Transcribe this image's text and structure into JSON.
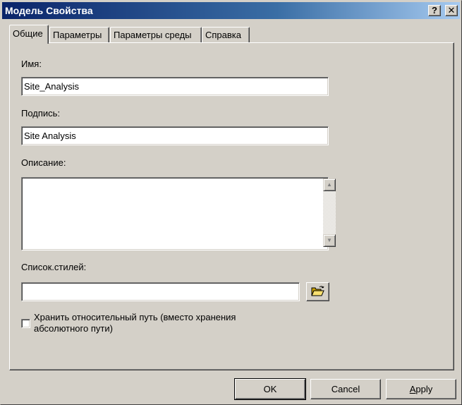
{
  "window": {
    "title": "Модель Свойства",
    "help_glyph": "?",
    "close_glyph": "✕"
  },
  "tabs": [
    {
      "label": "Общие",
      "active": true
    },
    {
      "label": "Параметры",
      "active": false
    },
    {
      "label": "Параметры среды",
      "active": false
    },
    {
      "label": "Справка",
      "active": false
    }
  ],
  "general": {
    "name_label": "Имя:",
    "name_value": "Site_Analysis",
    "caption_label": "Подпись:",
    "caption_value": "Site Analysis",
    "description_label": "Описание:",
    "description_value": "",
    "stylesheet_label": "Список.стилей:",
    "stylesheet_value": "",
    "browse_icon": "open-folder-icon",
    "relative_path_checked": false,
    "relative_path_label": "Хранить относительный путь (вместо хранения абсолютного пути)"
  },
  "buttons": {
    "ok": "OK",
    "cancel": "Cancel",
    "apply_first": "A",
    "apply_rest": "pply"
  },
  "colors": {
    "title_start": "#0a246a",
    "title_end": "#a6caf0",
    "face": "#d4d0c8"
  }
}
